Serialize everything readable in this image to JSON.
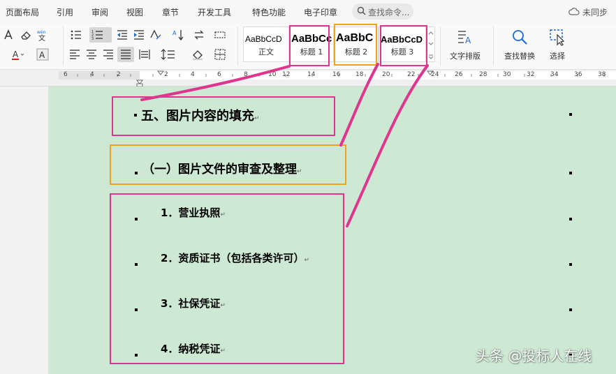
{
  "menu": {
    "items": [
      "页面布局",
      "引用",
      "审阅",
      "视图",
      "章节",
      "开发工具",
      "特色功能",
      "电子印章"
    ],
    "search_placeholder": "查找命令...",
    "sync_label": "未同步"
  },
  "toolbar": {
    "styles": [
      {
        "preview": "AaBbCcD",
        "name": "正文"
      },
      {
        "preview": "AaBbCc",
        "name": "标题 1"
      },
      {
        "preview": "AaBbC",
        "name": "标题 2"
      },
      {
        "preview": "AaBbCcD",
        "name": "标题 3"
      }
    ],
    "text_layout_label": "文字排版",
    "find_replace_label": "查找替换",
    "select_label": "选择",
    "phonetic_label": "wén"
  },
  "ruler": {
    "labels": [
      "6",
      "4",
      "2",
      "2",
      "4",
      "6",
      "8",
      "10",
      "12",
      "14",
      "16",
      "18",
      "20",
      "22",
      "24",
      "26",
      "28",
      "30",
      "32",
      "34",
      "36",
      "38"
    ]
  },
  "document": {
    "heading1": "五、图片内容的填充",
    "heading2": "（一）图片文件的审查及整理",
    "items": [
      "1．营业执照",
      "2．资质证书（包括各类许可）",
      "3．社保凭证",
      "4．纳税凭证"
    ],
    "paragraph_mark": "↵"
  },
  "watermark": "头条 @投标人在线",
  "colors": {
    "page_bg": "#cde8d3",
    "highlight_pink": "#e0358f",
    "highlight_orange": "#f0a21a"
  }
}
